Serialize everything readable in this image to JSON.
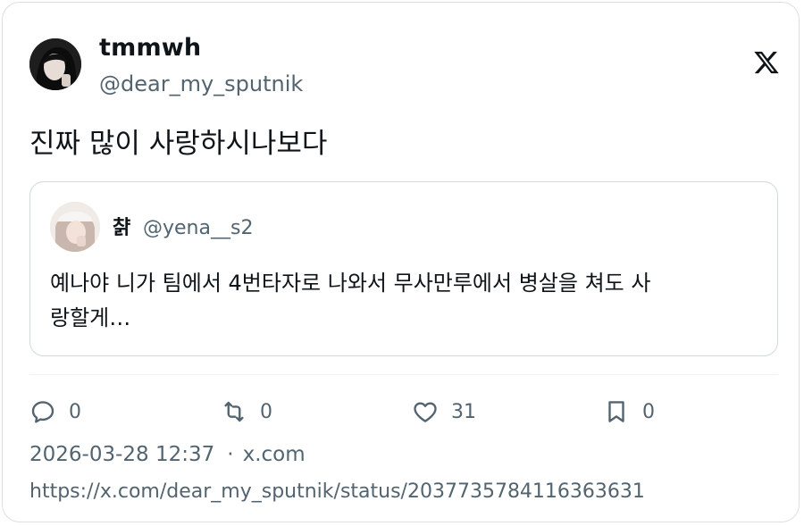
{
  "author": {
    "display_name": "tmmwh",
    "handle": "@dear_my_sputnik"
  },
  "logo_icon": "x-logo-icon",
  "tweet": {
    "text": "진짜 많이 사랑하시나보다"
  },
  "quoted_tweet": {
    "display_name": "챩",
    "handle": "@yena__s2",
    "text_line1": "예나야 니가 팀에서 4번타자로 나와서 무사만루에서 병살을 쳐도 사",
    "text_line2": "랑할게…"
  },
  "actions": {
    "reply_count": "0",
    "retweet_count": "0",
    "like_count": "31",
    "bookmark_count": "0"
  },
  "meta": {
    "datetime": "2026-03-28 12:37",
    "separator": "·",
    "source": "x.com"
  },
  "url": "https://x.com/dear_my_sputnik/status/2037735784116363631",
  "colors": {
    "text_primary": "#0f1419",
    "text_secondary": "#536471",
    "border": "#cfd9de"
  }
}
